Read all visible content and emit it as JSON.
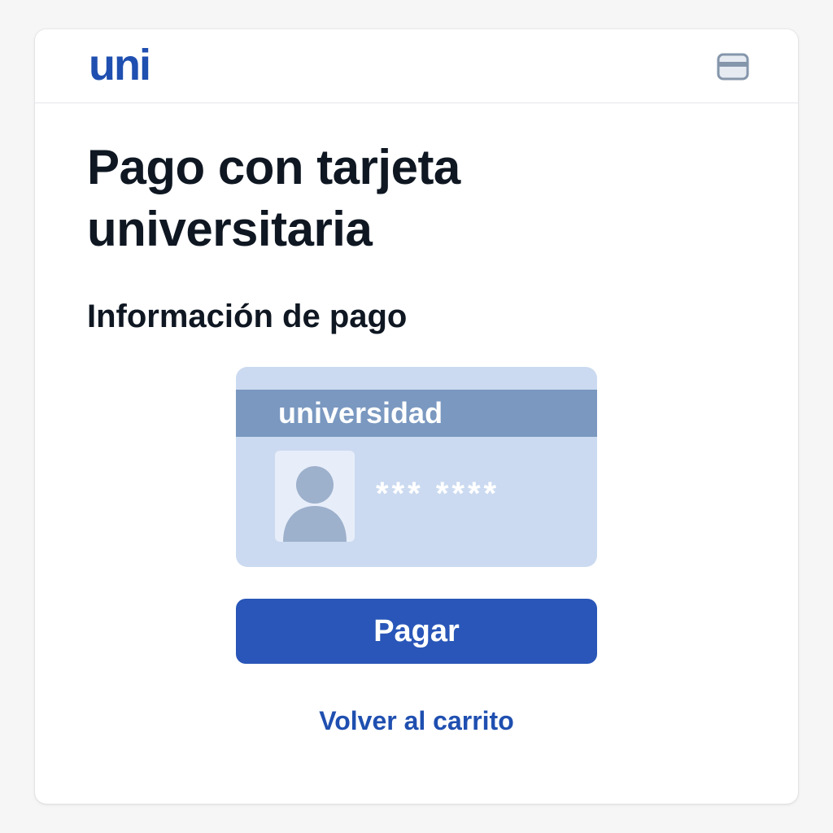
{
  "header": {
    "logo_text": "uni",
    "card_icon": "credit-card-icon"
  },
  "page": {
    "title": "Pago con tarjeta universitaria",
    "section_title": "Información de pago"
  },
  "student_card": {
    "band_text": "universidad",
    "masked_number": "*** ****",
    "photo_icon": "user-silhouette-icon"
  },
  "actions": {
    "pay_label": "Pagar",
    "back_label": "Volver al carrito"
  },
  "colors": {
    "brand": "#1f4fb0",
    "button": "#2956b8",
    "card_bg": "#cbdaf0",
    "card_band": "#7a98c0"
  }
}
